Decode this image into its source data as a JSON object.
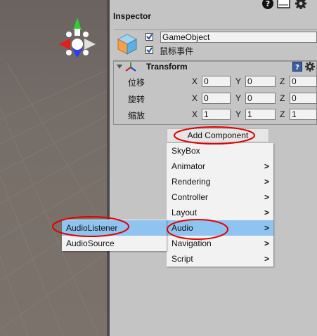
{
  "inspector": {
    "title": "Inspector",
    "object_name": "GameObject",
    "event_label": "鼠标事件",
    "object_active": true,
    "event_enabled": true
  },
  "transform": {
    "title": "Transform",
    "rows": [
      {
        "label": "位移",
        "x": "0",
        "y": "0",
        "z": "0"
      },
      {
        "label": "旋转",
        "x": "0",
        "y": "0",
        "z": "0"
      },
      {
        "label": "缩放",
        "x": "1",
        "y": "1",
        "z": "1"
      }
    ],
    "axes": {
      "x": "X",
      "y": "Y",
      "z": "Z"
    }
  },
  "add_component": {
    "label": "Add Component"
  },
  "menu": {
    "items": [
      {
        "label": "SkyBox",
        "arrow": ""
      },
      {
        "label": "Animator",
        "arrow": ">"
      },
      {
        "label": "Rendering",
        "arrow": ">"
      },
      {
        "label": "Controller",
        "arrow": ">"
      },
      {
        "label": "Layout",
        "arrow": ">"
      },
      {
        "label": "Audio",
        "arrow": ">"
      },
      {
        "label": "Navigation",
        "arrow": ">"
      },
      {
        "label": "Script",
        "arrow": ">"
      }
    ],
    "selected": "Audio"
  },
  "submenu": {
    "items": [
      {
        "label": "AudioListener"
      },
      {
        "label": "AudioSource"
      }
    ],
    "selected": "AudioListener"
  },
  "colors": {
    "highlight": "#8ec4ef",
    "annotation": "#e00000",
    "gizmo_x": "#e01010",
    "gizmo_y": "#20c020",
    "gizmo_z": "#1030e0"
  }
}
